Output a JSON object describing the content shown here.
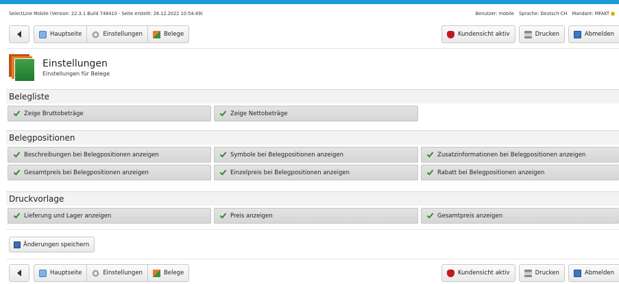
{
  "info": {
    "version_text": "SelectLine Mobile (Version: 22.3.1 Build 748410 - Seite erstellt: 28.12.2022 10:54:49)",
    "user": "Benutzer: mobile",
    "language": "Sprache: Deutsch-CH",
    "client": "Mandant: MFAKT"
  },
  "nav": {
    "home_label": "Hauptseite",
    "settings_label": "Einstellungen",
    "documents_label": "Belege",
    "customer_view_label": "Kundensicht aktiv",
    "print_label": "Drucken",
    "logout_label": "Abmelden"
  },
  "header": {
    "title": "Einstellungen",
    "subtitle": "Einstellungen für Belege"
  },
  "sections": [
    {
      "title": "Belegliste",
      "rows": [
        [
          "Zeige Bruttobeträge",
          "Zeige Nettobeträge"
        ]
      ]
    },
    {
      "title": "Belegpositionen",
      "rows": [
        [
          "Beschreibungen bei Belegpositionen anzeigen",
          "Symbole bei Belegpositionen anzeigen",
          "Zusatzinformationen bei Belegpositionen anzeigen"
        ],
        [
          "Gesamtpreis bei Belegpositionen anzeigen",
          "Einzelpreis bei Belegpositionen anzeigen",
          "Rabatt bei Belegpositionen anzeigen"
        ]
      ]
    },
    {
      "title": "Druckvorlage",
      "rows": [
        [
          "Lieferung und Lager anzeigen",
          "Preis anzeigen",
          "Gesamtpreis anzeigen"
        ]
      ]
    }
  ],
  "actions": {
    "save_label": "Änderungen speichern"
  },
  "colors": {
    "accent_bar": "#1b9ad6",
    "check": "#2e8b2e",
    "customer_view_icon": "#c0191f"
  },
  "icons": {
    "back": "back-arrow-icon",
    "home": "home-icon",
    "settings": "gear-icon",
    "documents": "documents-icon",
    "customer_view": "mask-icon",
    "print": "printer-icon",
    "logout": "logout-icon",
    "save": "floppy-disk-icon",
    "checked": "checkmark-icon"
  }
}
